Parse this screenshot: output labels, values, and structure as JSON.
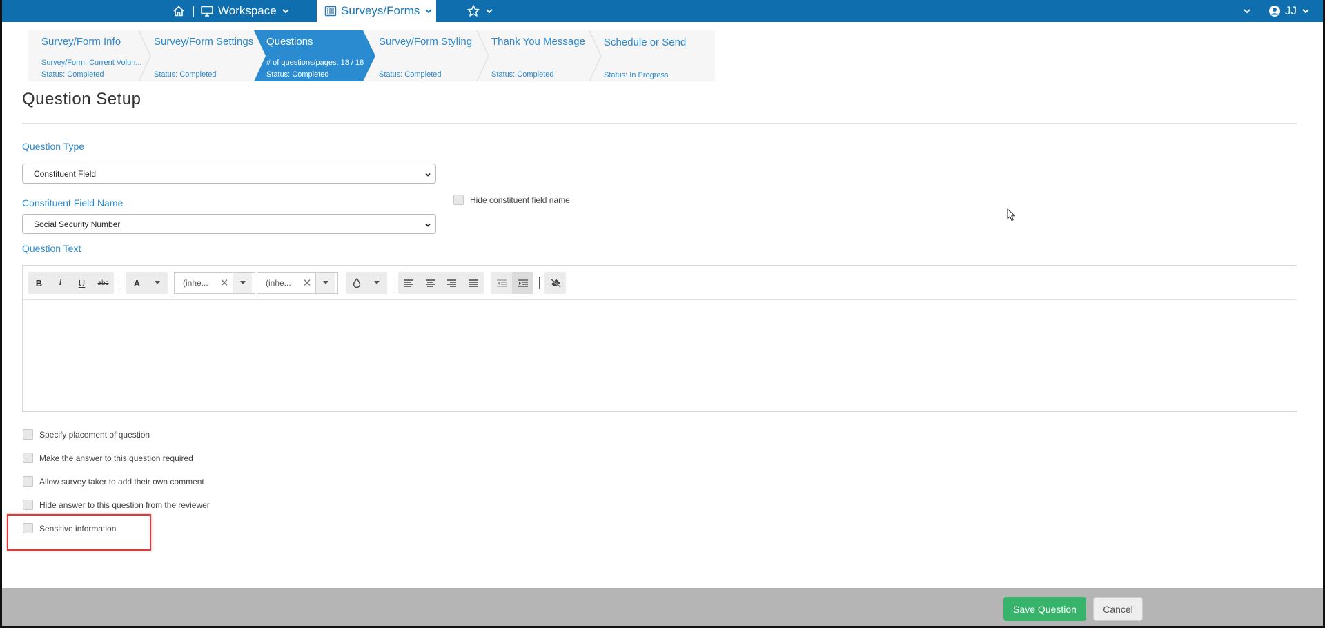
{
  "topnav": {
    "workspace_label": "Workspace",
    "separator": "|",
    "surveys_label": "Surveys/Forms",
    "user_initials": "JJ"
  },
  "steps": [
    {
      "title": "Survey/Form Info",
      "sub": "Survey/Form: Current Volun...",
      "status": "Status: Completed"
    },
    {
      "title": "Survey/Form Settings",
      "sub": "",
      "status": "Status: Completed"
    },
    {
      "title": "Questions",
      "sub": "# of questions/pages: 18 / 18",
      "status": "Status: Completed",
      "active": true
    },
    {
      "title": "Survey/Form Styling",
      "sub": "",
      "status": "Status: Completed"
    },
    {
      "title": "Thank You Message",
      "sub": "",
      "status": "Status: Completed"
    },
    {
      "title": "Schedule or Send",
      "sub": "",
      "status": "Status: In Progress"
    }
  ],
  "page": {
    "title": "Question Setup",
    "question_type_label": "Question Type",
    "question_type_value": "Constituent Field",
    "field_name_label": "Constituent Field Name",
    "field_name_value": "Social Security Number",
    "hide_field_name_label": "Hide constituent field name",
    "question_text_label": "Question Text"
  },
  "editor": {
    "bold": "B",
    "italic": "I",
    "underline": "U",
    "strike": "abc",
    "font_color": "A",
    "font_name": "(inhe...",
    "font_size": "(inhe...",
    "clear": "✕"
  },
  "options": [
    "Specify placement of question",
    "Make the answer to this question required",
    "Allow survey taker to add their own comment",
    "Hide answer to this question from the reviewer",
    "Sensitive information"
  ],
  "footer": {
    "save_label": "Save Question",
    "cancel_label": "Cancel"
  },
  "colors": {
    "nav_bg": "#0f6fae",
    "accent": "#2a8bd0",
    "save_green": "#37b36b",
    "highlight_red": "#e0393a"
  }
}
